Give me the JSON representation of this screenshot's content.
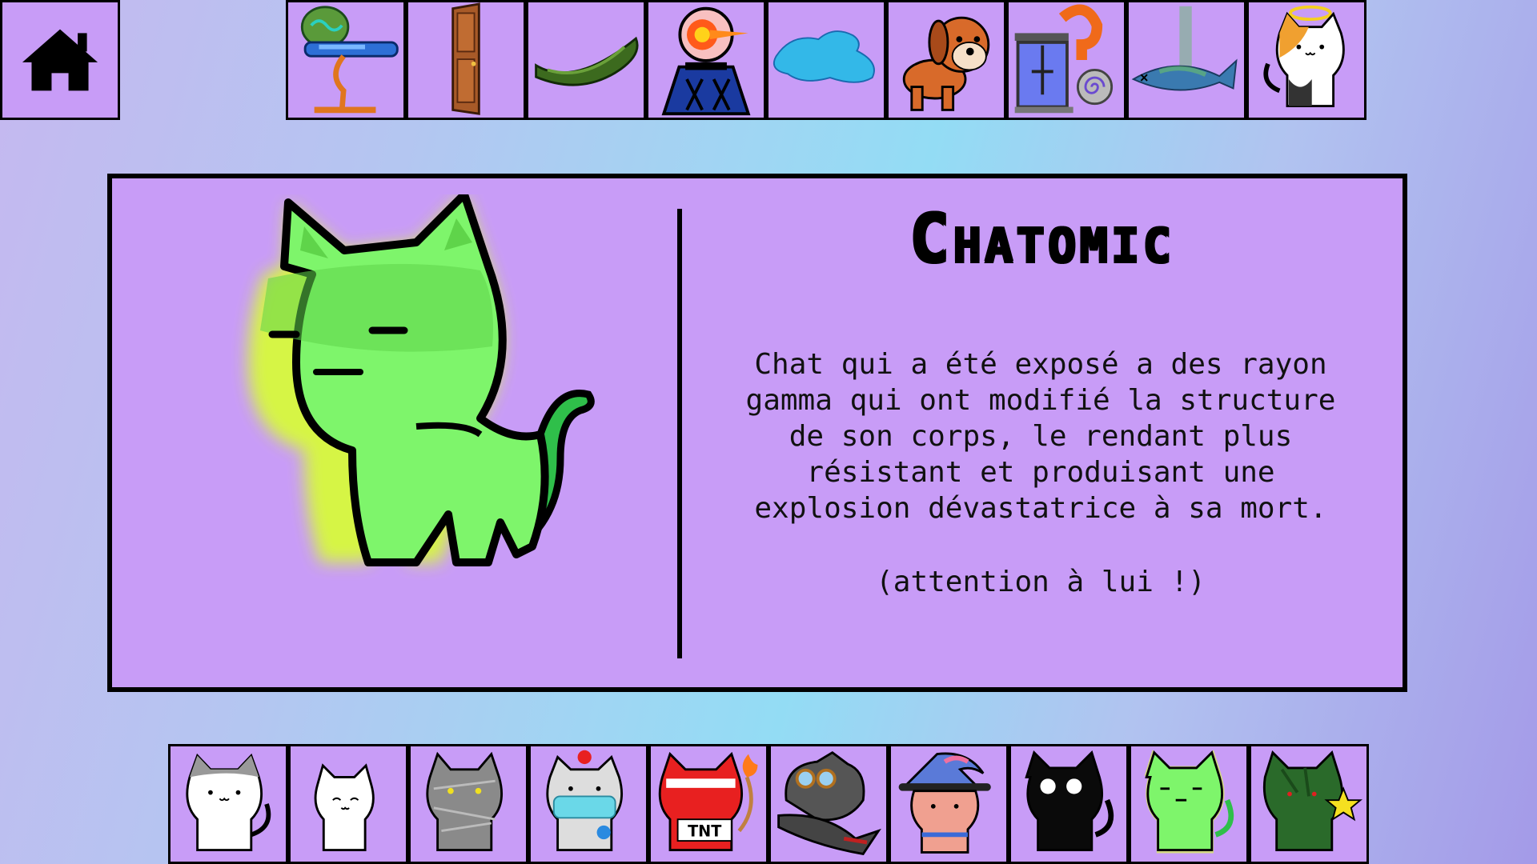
{
  "home": {
    "icon": "home-icon"
  },
  "top_items": [
    {
      "name": "tesla-cannon-turret-icon"
    },
    {
      "name": "wooden-door-icon"
    },
    {
      "name": "cucumber-icon"
    },
    {
      "name": "fire-orb-tower-icon"
    },
    {
      "name": "water-puddle-icon"
    },
    {
      "name": "dog-icon"
    },
    {
      "name": "hypno-machine-icon"
    },
    {
      "name": "fish-icon"
    },
    {
      "name": "angel-calico-cat-icon"
    }
  ],
  "character": {
    "name": "Chatomic",
    "description": "Chat qui a été exposé a des rayon\ngamma qui ont modifié la structure\nde son corps, le rendant plus\nrésistant et produisant une\nexplosion dévastatrice à sa mort.",
    "note": "(attention à lui !)",
    "colors": {
      "body": "#7ef56b",
      "glow": "#d8ff33",
      "tail": "#2fbf4a"
    }
  },
  "bottom_cats": [
    {
      "name": "grey-white-cat-icon"
    },
    {
      "name": "white-cat-icon"
    },
    {
      "name": "mummy-cat-icon"
    },
    {
      "name": "medic-cat-icon"
    },
    {
      "name": "tnt-cat-icon"
    },
    {
      "name": "aviator-cat-icon"
    },
    {
      "name": "wizard-cat-icon"
    },
    {
      "name": "shadow-cat-icon"
    },
    {
      "name": "chatomic-cat-icon"
    },
    {
      "name": "zombie-cat-icon"
    }
  ],
  "colors": {
    "tile": "#c89cf7",
    "border": "#000000"
  }
}
